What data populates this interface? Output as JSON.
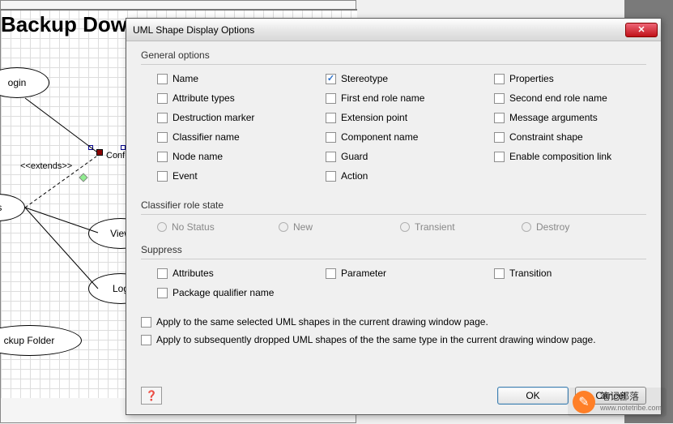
{
  "background": {
    "title": "Backup Dow",
    "nodes": {
      "login": "ogin",
      "view": "View",
      "log": "Log",
      "backup_folder": "ckup Folder",
      "config": "Config",
      "gs": "gs"
    },
    "stereotype_label": "<<extends>>"
  },
  "modal": {
    "title": "UML Shape Display Options",
    "groups": {
      "general": {
        "label": "General options",
        "items": {
          "name": {
            "label": "Name",
            "checked": false
          },
          "stereotype": {
            "label": "Stereotype",
            "checked": true
          },
          "properties": {
            "label": "Properties",
            "checked": false
          },
          "attribute_types": {
            "label": "Attribute types",
            "checked": false
          },
          "first_end_role": {
            "label": "First end role name",
            "checked": false
          },
          "second_end_role": {
            "label": "Second end role name",
            "checked": false
          },
          "destruction_marker": {
            "label": "Destruction marker",
            "checked": false
          },
          "extension_point": {
            "label": "Extension point",
            "checked": false
          },
          "message_arguments": {
            "label": "Message arguments",
            "checked": false
          },
          "classifier_name": {
            "label": "Classifier name",
            "checked": false
          },
          "component_name": {
            "label": "Component name",
            "checked": false
          },
          "constraint_shape": {
            "label": "Constraint shape",
            "checked": false
          },
          "node_name": {
            "label": "Node name",
            "checked": false
          },
          "guard": {
            "label": "Guard",
            "checked": false
          },
          "enable_composition": {
            "label": "Enable composition link",
            "checked": false
          },
          "event": {
            "label": "Event",
            "checked": false
          },
          "action": {
            "label": "Action",
            "checked": false
          }
        }
      },
      "classifier_role": {
        "label": "Classifier role state",
        "options": [
          "No Status",
          "New",
          "Transient",
          "Destroy"
        ]
      },
      "suppress": {
        "label": "Suppress",
        "items": {
          "attributes": {
            "label": "Attributes"
          },
          "parameter": {
            "label": "Parameter"
          },
          "transition": {
            "label": "Transition"
          },
          "package_qualifier": {
            "label": "Package qualifier name"
          }
        }
      }
    },
    "apply_same": "Apply to the same selected UML shapes in the current drawing window page.",
    "apply_subsequent": "Apply to subsequently dropped UML shapes of the the same type in the current drawing window page.",
    "buttons": {
      "ok": "OK",
      "cancel": "Cancel",
      "help": "?"
    }
  },
  "watermark": {
    "name": "笔记部落",
    "url": "www.notetribe.com"
  }
}
